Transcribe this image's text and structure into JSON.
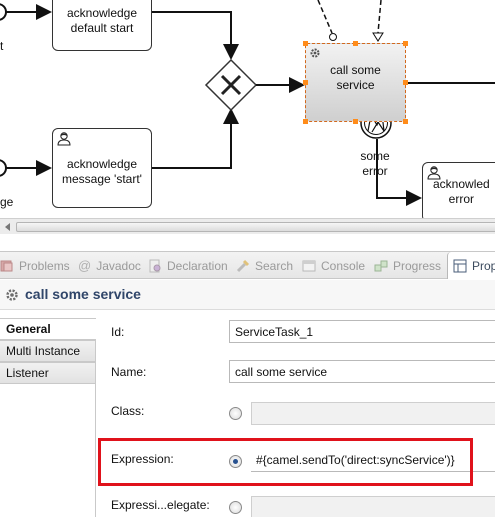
{
  "diagram": {
    "tasks": {
      "ack_default": "acknowledge\ndefault start",
      "ack_message": "acknowledge\nmessage 'start'",
      "call_service": "call some\nservice",
      "ack_error": "acknowled\nerror"
    },
    "boundary_label": "some\nerror",
    "left_fragments": {
      "top": "t",
      "bottom": "ge"
    },
    "icons": {
      "gateway": "exclusive-gateway-x",
      "user_task": "user-icon",
      "service_task": "gear-icon",
      "boundary": "error-event-icon"
    },
    "colors": {
      "selection_handle": "#ff8c1a",
      "selection_border": "#d2691e"
    }
  },
  "tabs": [
    {
      "label": "Problems",
      "icon": "problems-icon",
      "active": false
    },
    {
      "label": "Javadoc",
      "icon": "javadoc-icon",
      "active": false
    },
    {
      "label": "Declaration",
      "icon": "declaration-icon",
      "active": false
    },
    {
      "label": "Search",
      "icon": "search-icon",
      "active": false
    },
    {
      "label": "Console",
      "icon": "console-icon",
      "active": false
    },
    {
      "label": "Progress",
      "icon": "progress-icon",
      "active": false
    },
    {
      "label": "Prop",
      "icon": "properties-icon",
      "active": true
    }
  ],
  "properties": {
    "title": "call some service",
    "side_tabs": [
      "General",
      "Multi Instance",
      "Listener"
    ],
    "fields": {
      "id_label": "Id:",
      "id_value": "ServiceTask_1",
      "name_label": "Name:",
      "name_value": "call some service",
      "class_label": "Class:",
      "class_value": "",
      "expression_label": "Expression:",
      "expression_value": "#{camel.sendTo('direct:syncService')}",
      "delegate_label": "Expressi...elegate:",
      "delegate_value": ""
    },
    "selected_option": "expression",
    "highlight_color": "#e0121b"
  }
}
